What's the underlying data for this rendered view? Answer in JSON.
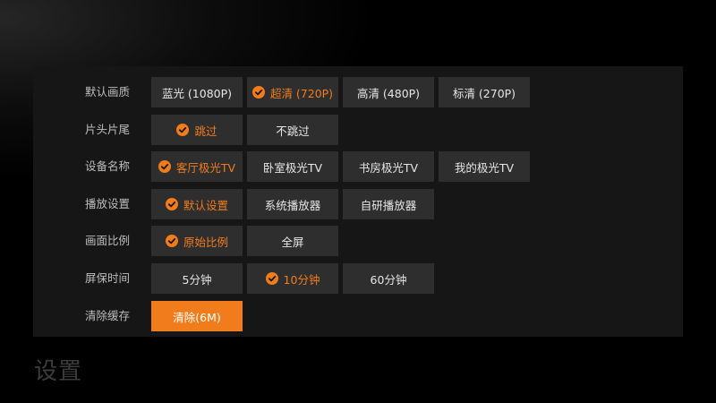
{
  "title": "设置",
  "rows": [
    {
      "label": "默认画质",
      "options": [
        {
          "label": "蓝光 (1080P)",
          "selected": false
        },
        {
          "label": "超清 (720P)",
          "selected": true
        },
        {
          "label": "高清 (480P)",
          "selected": false
        },
        {
          "label": "标清 (270P)",
          "selected": false
        }
      ]
    },
    {
      "label": "片头片尾",
      "options": [
        {
          "label": "跳过",
          "selected": true
        },
        {
          "label": "不跳过",
          "selected": false
        }
      ]
    },
    {
      "label": "设备名称",
      "options": [
        {
          "label": "客厅极光TV",
          "selected": true
        },
        {
          "label": "卧室极光TV",
          "selected": false
        },
        {
          "label": "书房极光TV",
          "selected": false
        },
        {
          "label": "我的极光TV",
          "selected": false
        }
      ]
    },
    {
      "label": "播放设置",
      "options": [
        {
          "label": "默认设置",
          "selected": true
        },
        {
          "label": "系统播放器",
          "selected": false
        },
        {
          "label": "自研播放器",
          "selected": false
        }
      ]
    },
    {
      "label": "画面比例",
      "options": [
        {
          "label": "原始比例",
          "selected": true
        },
        {
          "label": "全屏",
          "selected": false
        }
      ]
    },
    {
      "label": "屏保时间",
      "options": [
        {
          "label": "5分钟",
          "selected": false
        },
        {
          "label": "10分钟",
          "selected": true
        },
        {
          "label": "60分钟",
          "selected": false
        }
      ]
    },
    {
      "label": "清除缓存",
      "options": [
        {
          "label": "清除(6M)",
          "selected": false,
          "focused": true
        }
      ]
    }
  ],
  "colors": {
    "accent": "#f07c1c",
    "button_bg": "#2e2e2e",
    "panel_bg": "#161616",
    "label_text": "#bdbdbd"
  },
  "icons": {
    "selected": "check-circle-icon"
  }
}
